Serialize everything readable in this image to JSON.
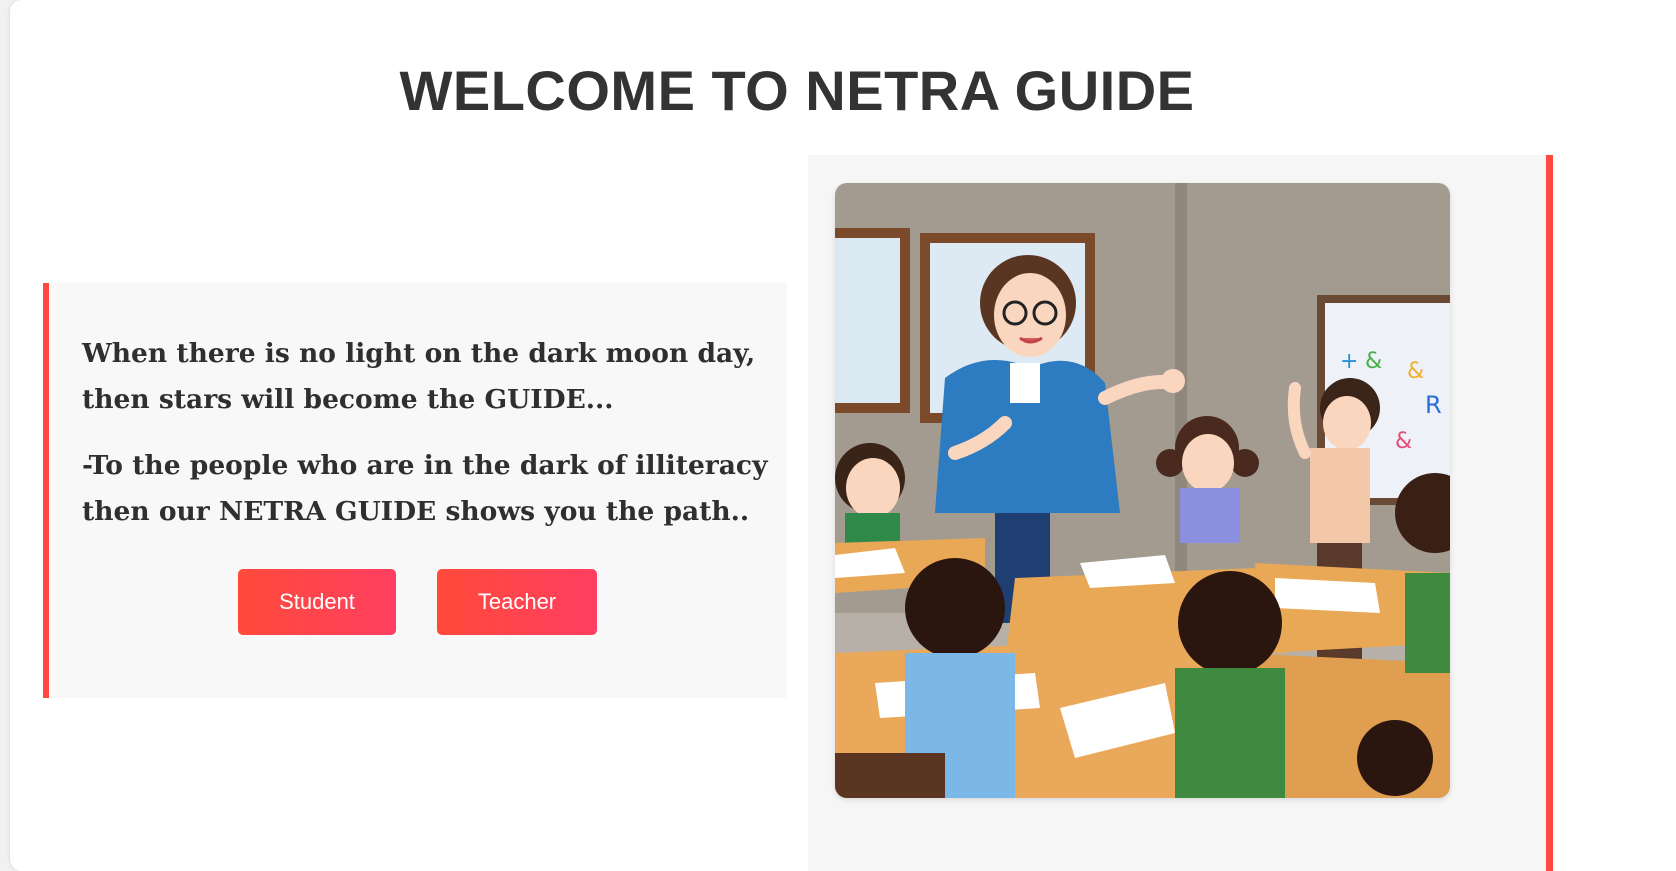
{
  "page": {
    "title": "WELCOME TO NETRA GUIDE"
  },
  "intro": {
    "line1": "When there is no light on the dark moon day,",
    "line2": "then stars will become the GUIDE...",
    "line3": "-To the people who are in the dark of illiteracy",
    "line4": "then our NETRA GUIDE shows you the path.."
  },
  "actions": {
    "student_label": "Student",
    "teacher_label": "Teacher"
  },
  "theme": {
    "accent": "#ff4a3d",
    "button_gradient_start": "#ff4a3a",
    "button_gradient_end": "#ff3f61",
    "title_color": "#333333"
  },
  "illustration": {
    "subject": "cartoon-classroom-teacher-with-students"
  }
}
